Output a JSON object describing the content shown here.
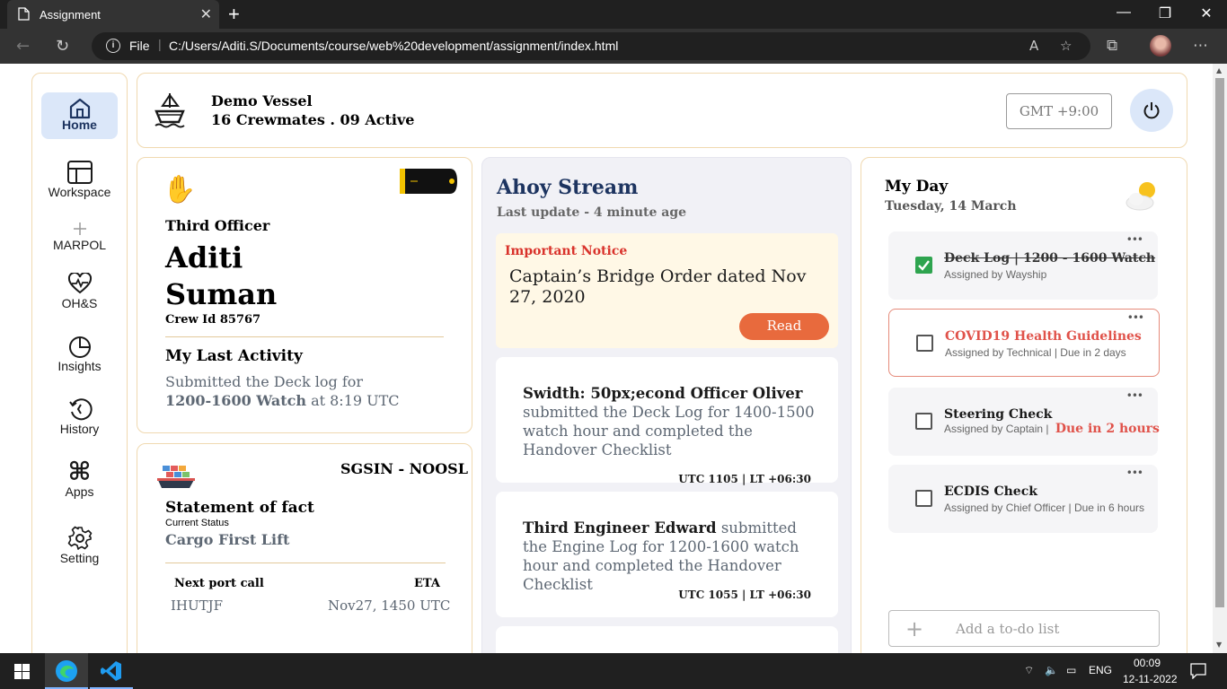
{
  "browser": {
    "tab_title": "Assignment",
    "address_scheme": "File",
    "url": "C:/Users/Aditi.S/Documents/course/web%20development/assignment/index.html"
  },
  "sidebar": {
    "items": [
      {
        "label": "Home",
        "icon": "home-icon",
        "active": true
      },
      {
        "label": "Workspace",
        "icon": "workspace-icon"
      },
      {
        "label": "MARPOL",
        "icon": "plus-icon"
      },
      {
        "label": "OH&S",
        "icon": "heart-pulse-icon"
      },
      {
        "label": "Insights",
        "icon": "pie-chart-icon"
      },
      {
        "label": "History",
        "icon": "history-icon"
      },
      {
        "label": "Apps",
        "icon": "command-icon"
      },
      {
        "label": "Setting",
        "icon": "gear-icon"
      }
    ]
  },
  "header": {
    "vessel_name": "Demo Vessel",
    "crew_status": "16 Crewmates . 09 Active",
    "timezone": "GMT +9:00"
  },
  "profile": {
    "rank": "Third Officer",
    "first_name": "Aditi",
    "last_name": "Suman",
    "crew_id": "Crew Id 85767",
    "activity_title": "My Last Activity",
    "activity_line1": "Submitted the Deck log for",
    "activity_watch": "1200-1600 Watch",
    "activity_time": " at 8:19 UTC"
  },
  "port": {
    "route": "SGSIN - NOOSL",
    "title": "Statement of fact",
    "status_label": "Current Status",
    "status_value": "Cargo First Lift",
    "next_port_label": "Next port call",
    "eta_label": "ETA",
    "next_port_value": "IHUTJF",
    "eta_value": "Nov27, 1450 UTC"
  },
  "stream": {
    "title": "Ahoy Stream",
    "subtitle": "Last update - 4 minute age",
    "notice": {
      "label": "Important Notice",
      "text": "Captain’s Bridge Order dated Nov 27, 2020",
      "button": "Read"
    },
    "posts": [
      {
        "author": "Swidth: 50px;econd Officer Oliver",
        "text": " submitted the Deck Log for 1400-1500 watch hour and completed the Handover Checklist",
        "meta": "UTC 1105 | LT +06:30"
      },
      {
        "author": "Third Engineer Edward",
        "text": " submitted the Engine Log for 1200-1600 watch hour and completed the Handover Checklist",
        "meta": "UTC 1055 | LT +06:30"
      }
    ]
  },
  "myday": {
    "title": "My Day",
    "date": "Tuesday, 14 March",
    "tasks": [
      {
        "title": "Deck Log | 1200 - 1600 Watch",
        "sub": "Assigned by Wayship",
        "done": true
      },
      {
        "title": "COVID19 Health Guidelines",
        "sub": "Assigned by Technical | Due in 2 days"
      },
      {
        "title": "Steering Check",
        "sub": "Assigned by Captain | ",
        "due": "Due in 2 hours"
      },
      {
        "title": "ECDIS Check",
        "sub": "Assigned by Chief Officer | Due in 6 hours"
      }
    ],
    "add_placeholder": "Add a to-do list"
  },
  "taskbar": {
    "lang": "ENG",
    "time": "00:09",
    "date": "12-11-2022"
  }
}
